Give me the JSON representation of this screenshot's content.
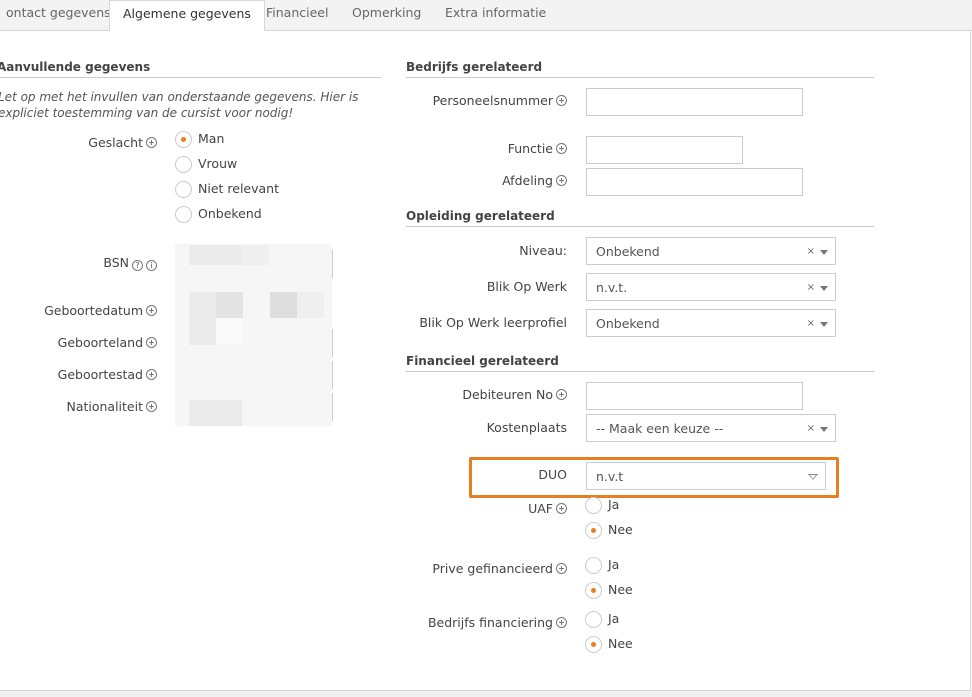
{
  "tabs": [
    {
      "label": "ontact gegevens",
      "active": false
    },
    {
      "label": "Algemene gegevens",
      "active": true
    },
    {
      "label": "Financieel",
      "active": false
    },
    {
      "label": "Opmerking",
      "active": false
    },
    {
      "label": "Extra informatie",
      "active": false
    }
  ],
  "left": {
    "section_title": "Aanvullende gegevens",
    "note": "Let op met het invullen van onderstaande gegevens. Hier is expliciet toestemming van de cursist voor nodig!",
    "gender_label": "Geslacht",
    "gender_options": [
      "Man",
      "Vrouw",
      "Niet relevant",
      "Onbekend"
    ],
    "gender_selected": "Man",
    "bsn_label": "BSN",
    "birthdate_label": "Geboortedatum",
    "birthcountry_label": "Geboorteland",
    "birthcity_label": "Geboortestad",
    "nationality_label": "Nationaliteit"
  },
  "right": {
    "company_section": "Bedrijfs gerelateerd",
    "employee_number_label": "Personeelsnummer",
    "function_label": "Functie",
    "department_label": "Afdeling",
    "education_section": "Opleiding gerelateerd",
    "level_label": "Niveau:",
    "level_value": "Onbekend",
    "bow_label": "Blik Op Werk",
    "bow_value": "n.v.t.",
    "bow_profile_label": "Blik Op Werk leerprofiel",
    "bow_profile_value": "Onbekend",
    "finance_section": "Financieel gerelateerd",
    "debtor_label": "Debiteuren No",
    "costcenter_label": "Kostenplaats",
    "costcenter_value": "-- Maak een keuze --",
    "duo_label": "DUO",
    "duo_value": "n.v.t",
    "uaf_label": "UAF",
    "private_label": "Prive gefinancieerd",
    "company_fin_label": "Bedrijfs financiering",
    "yes": "Ja",
    "no": "Nee",
    "clear_symbol": "×"
  },
  "colors": {
    "accent": "#e67e22",
    "border": "#cccccc"
  }
}
